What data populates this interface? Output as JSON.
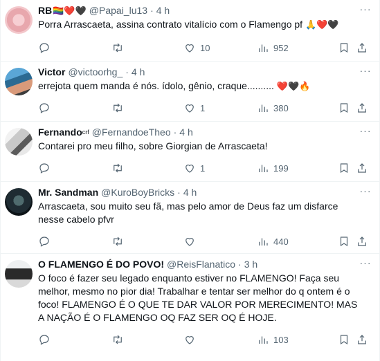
{
  "tweets": [
    {
      "name": "RB",
      "name_suffix": "🏳️‍🌈❤️🖤",
      "handle": "@Papai_lu13",
      "dot": "·",
      "time": "4 h",
      "text": "Porra Arrascaeta, assina contrato vitalício com o Flamengo pf",
      "text_emoji": "🙏❤️🖤",
      "replies": "",
      "retweets": "",
      "likes": "10",
      "views": "952"
    },
    {
      "name": "Victor",
      "handle": "@victoorhg_",
      "dot": "·",
      "time": "4 h",
      "text": "errejota quem manda é nós. ídolo, gênio, craque..........",
      "text_emoji": "❤️🖤🔥",
      "replies": "",
      "retweets": "",
      "likes": "1",
      "views": "380"
    },
    {
      "name": "Fernando",
      "name_suffix": "crf",
      "handle": "@FernandoeTheo",
      "dot": "·",
      "time": "4 h",
      "text": "Contarei pro meu filho, sobre Giorgian de Arrascaeta!",
      "replies": "",
      "retweets": "",
      "likes": "1",
      "views": "199"
    },
    {
      "name": "Mr. Sandman",
      "handle": "@KuroBoyBricks",
      "dot": "·",
      "time": "4 h",
      "text": "Arrascaeta, sou muito seu fã, mas pelo amor de Deus faz um disfarce nesse cabelo pfvr",
      "replies": "",
      "retweets": "",
      "likes": "",
      "views": "440"
    },
    {
      "name": "O FLAMENGO É DO POVO!",
      "handle": "@ReisFlanatico",
      "dot": "·",
      "time": "3 h",
      "text": "O foco é fazer seu legado enquanto estiver no FLAMENGO! Faça seu melhor, mesmo no pior dia! Trabalhar e tentar ser  melhor do q ontem é o foco! FLAMENGO É O QUE TE DAR VALOR POR MERECIMENTO! MAS A NAÇÃO É O FLAMENGO OQ FAZ SER OQ É HOJE.",
      "replies": "",
      "retweets": "",
      "likes": "",
      "views": "103"
    }
  ],
  "more_icon": "more-dots-icon",
  "icons": [
    "reply-icon",
    "retweet-icon",
    "like-icon",
    "views-icon",
    "bookmark-icon",
    "share-icon"
  ]
}
